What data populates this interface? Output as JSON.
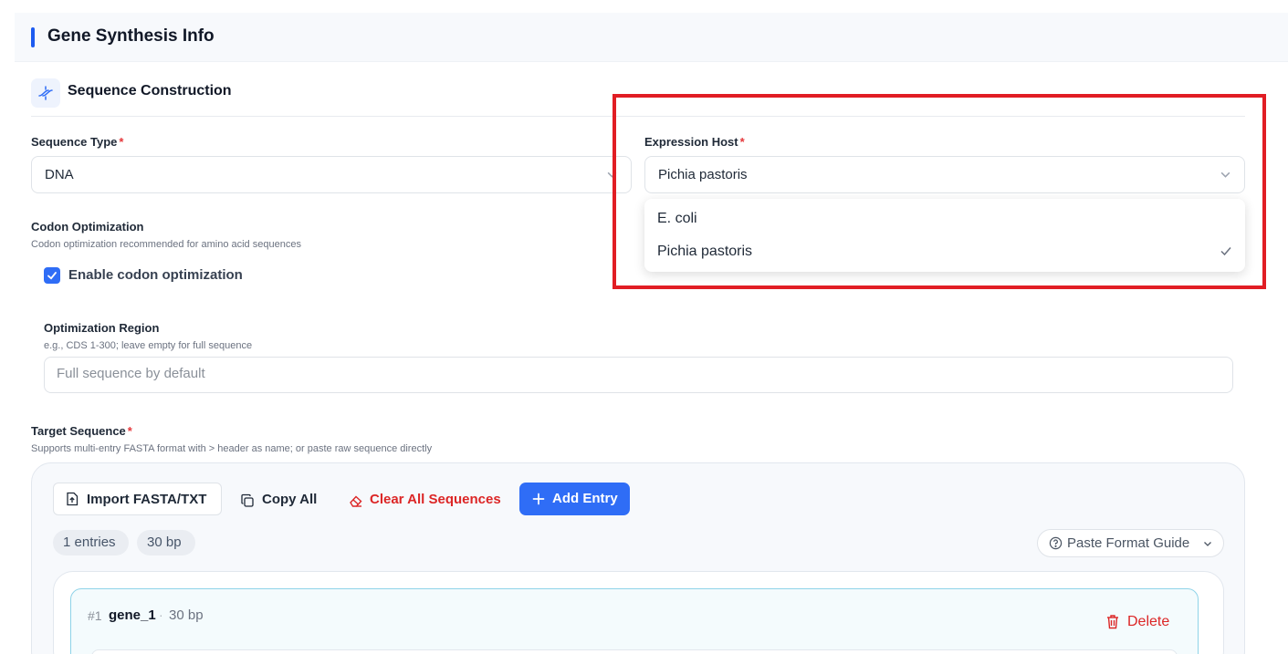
{
  "header": {
    "title": "Gene Synthesis Info"
  },
  "section": {
    "title": "Sequence Construction",
    "icon": "dna-icon"
  },
  "sequence_type": {
    "label": "Sequence Type",
    "required_mark": "*",
    "value": "DNA"
  },
  "expression_host": {
    "label": "Expression Host",
    "required_mark": "*",
    "value": "Pichia pastoris",
    "options": [
      {
        "label": "E. coli",
        "selected": false
      },
      {
        "label": "Pichia pastoris",
        "selected": true
      }
    ]
  },
  "codon_optimization": {
    "label": "Codon Optimization",
    "hint": "Codon optimization recommended for amino acid sequences",
    "checkbox_label": "Enable codon optimization",
    "checked": true
  },
  "optimization_region": {
    "label": "Optimization Region",
    "hint": "e.g., CDS 1-300; leave empty for full sequence",
    "placeholder": "Full sequence by default",
    "value": ""
  },
  "target_sequence": {
    "label": "Target Sequence",
    "required_mark": "*",
    "hint": "Supports multi-entry FASTA format with > header as name; or paste raw sequence directly"
  },
  "toolbar": {
    "import_label": "Import FASTA/TXT",
    "copy_label": "Copy All",
    "clear_label": "Clear All Sequences",
    "add_label": "Add Entry"
  },
  "stats": {
    "entries": "1 entries",
    "bp": "30 bp"
  },
  "paste_guide": {
    "label": "Paste Format Guide"
  },
  "entries": [
    {
      "index": "#1",
      "name": "gene_1",
      "separator": "·",
      "length": "30 bp",
      "delete_label": "Delete"
    }
  ],
  "colors": {
    "accent": "#2f6df6",
    "danger": "#dc2626",
    "highlight_box": "#e11d24",
    "entry_border": "#8fd3e8"
  }
}
